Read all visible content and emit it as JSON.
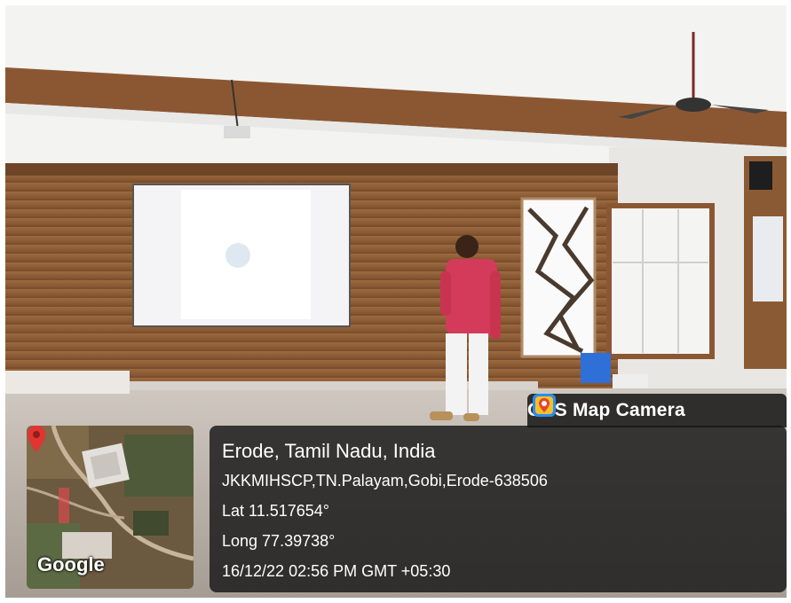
{
  "overlay": {
    "app_name": "GPS Map Camera",
    "map_attribution": "Google",
    "location_title": "Erode, Tamil Nadu, India",
    "address": "JKKMIHSCP,TN.Palayam,Gobi,Erode-638506",
    "latitude": "Lat 11.517654°",
    "longitude": "Long 77.39738°",
    "timestamp": "16/12/22 02:56 PM GMT +05:30"
  },
  "icons": {
    "app": "gps-camera-icon",
    "pin": "map-pin-icon"
  },
  "colors": {
    "wood_panel": "#8a5a34",
    "ceiling": "#f2f2f0",
    "shirt": "#d43a5a",
    "pin": "#e3342f"
  }
}
